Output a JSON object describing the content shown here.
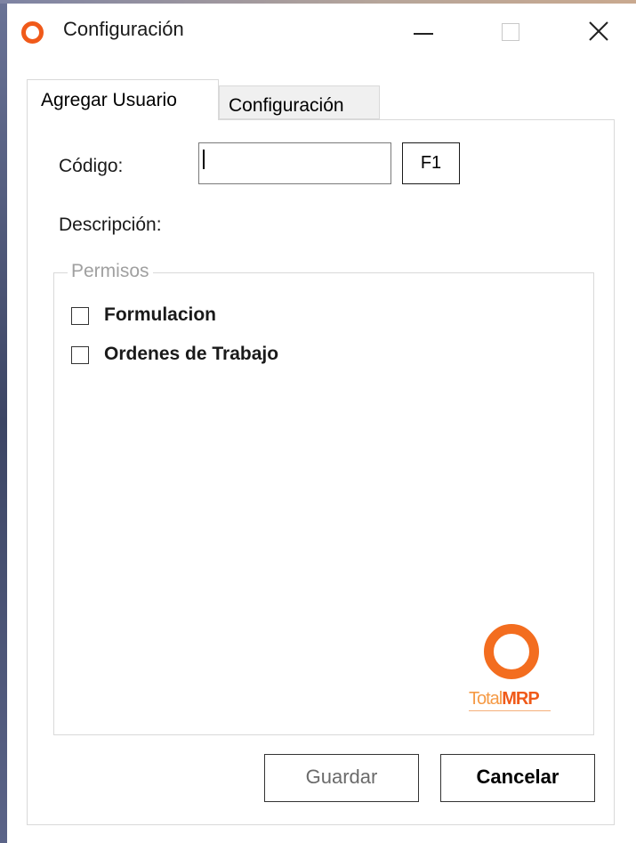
{
  "window": {
    "title": "Configuración",
    "controls": [
      "minimize-icon",
      "maximize-icon",
      "close-icon"
    ]
  },
  "tabs": [
    {
      "label": "Agregar Usuario",
      "active": true
    },
    {
      "label": "Configuración",
      "active": false
    }
  ],
  "form": {
    "codigo_label": "Código:",
    "codigo_value": "",
    "f1_label": "F1",
    "descripcion_label": "Descripción:"
  },
  "permisos": {
    "legend": "Permisos",
    "items": [
      {
        "label": "Formulacion",
        "checked": false
      },
      {
        "label": "Ordenes de Trabajo",
        "checked": false
      }
    ]
  },
  "brand": {
    "name_part1": "Total",
    "name_part2": "MRP"
  },
  "buttons": {
    "guardar": "Guardar",
    "cancelar": "Cancelar"
  },
  "colors": {
    "accent": "#f05a1a",
    "brand_light": "#f59a45",
    "disabled_text": "#6b6b6b"
  }
}
